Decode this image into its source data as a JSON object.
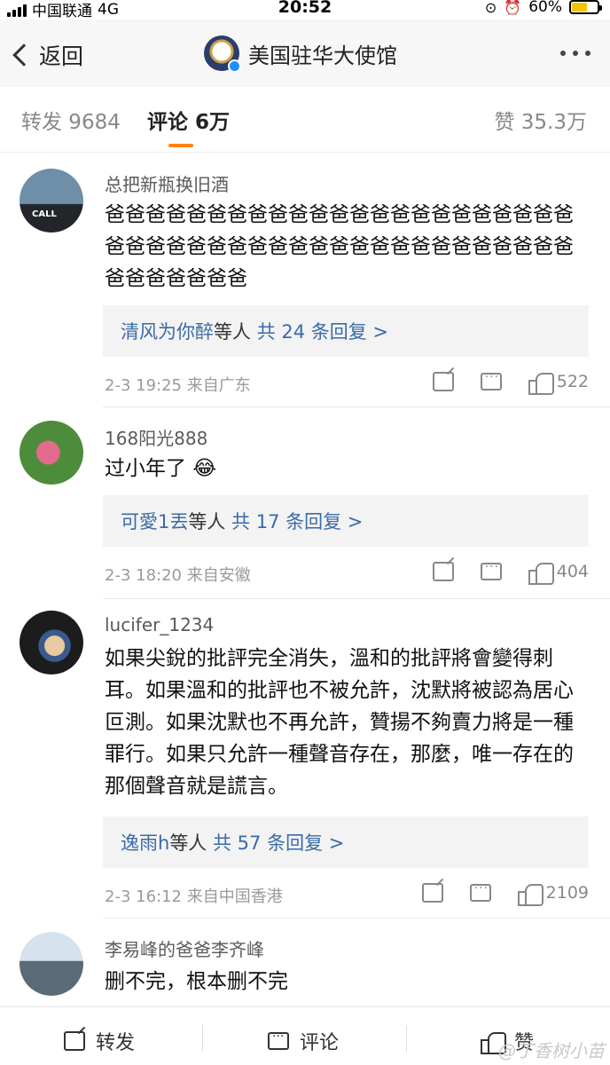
{
  "status_bar": {
    "carrier": "中国联通",
    "network": "4G",
    "time": "20:52",
    "battery": "60%",
    "battery_level": 0.6
  },
  "nav": {
    "back_label": "返回",
    "title": "美国驻华大使馆"
  },
  "tabs": {
    "repost": "转发 9684",
    "comment": "评论 6万",
    "like": "赞 35.3万"
  },
  "comments": [
    {
      "username": "总把新瓶换旧酒",
      "text": "爸爸爸爸爸爸爸爸爸爸爸爸爸爸爸爸爸爸爸爸爸爸爸爸爸爸爸爸爸爸爸爸爸爸爸爸爸爸爸爸爸爸爸爸爸爸爸爸爸爸爸爸爸",
      "reply_users": "清风为你醉",
      "reply_mid": "等人",
      "reply_count": "共 24 条回复 >",
      "meta": "2-3 19:25  来自广东",
      "likes": "522"
    },
    {
      "username": "168阳光888",
      "text": "过小年了 😂",
      "reply_users": "可愛1丟",
      "reply_mid": "等人",
      "reply_count": "共 17 条回复 >",
      "meta": "2-3 18:20  来自安徽",
      "likes": "404"
    },
    {
      "username": "lucifer_1234",
      "text": "如果尖銳的批評完全消失，溫和的批評將會變得刺耳。如果溫和的批評也不被允許，沈默將被認為居心叵測。如果沈默也不再允許，贊揚不夠賣力將是一種罪行。如果只允許一種聲音存在，那麼，唯一存在的那個聲音就是謊言。",
      "reply_users": "逸雨h",
      "reply_mid": "等人",
      "reply_count": "共 57 条回复 >",
      "meta": "2-3 16:12  来自中国香港",
      "likes": "2109"
    },
    {
      "username": "李易峰的爸爸李齐峰",
      "text": "删不完，根本删不完"
    }
  ],
  "bottom_bar": {
    "repost": "转发",
    "comment": "评论",
    "like": "赞"
  },
  "watermark": "@丁香树小苗"
}
